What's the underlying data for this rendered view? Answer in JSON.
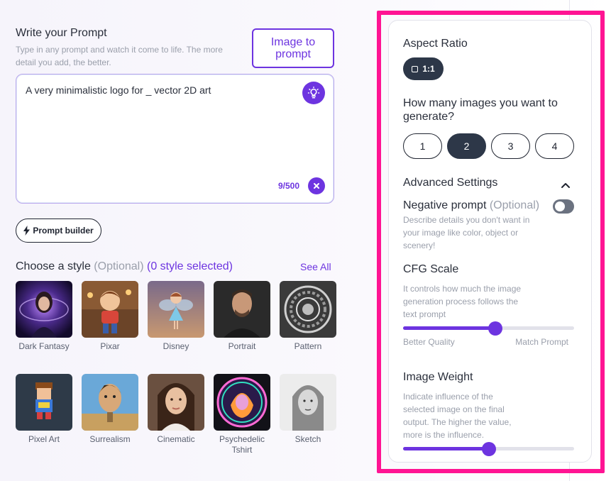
{
  "prompt": {
    "title": "Write your Prompt",
    "description": "Type in any prompt and watch it come to life. The more detail you add, the better.",
    "image_to_prompt_label": "Image to prompt",
    "value": "A very minimalistic logo for _ vector 2D art",
    "counter": "9/500",
    "builder_label": "Prompt builder"
  },
  "style": {
    "title": "Choose a style",
    "optional": "(Optional)",
    "selected": "(0 style selected)",
    "see_all": "See All",
    "tiles": [
      {
        "label": "Dark Fantasy"
      },
      {
        "label": "Pixar"
      },
      {
        "label": "Disney"
      },
      {
        "label": "Portrait"
      },
      {
        "label": "Pattern"
      },
      {
        "label": "Pixel Art"
      },
      {
        "label": "Surrealism"
      },
      {
        "label": "Cinematic"
      },
      {
        "label": "Psychedelic Tshirt"
      },
      {
        "label": "Sketch"
      }
    ]
  },
  "settings": {
    "aspect_ratio_title": "Aspect Ratio",
    "aspect_ratio_value": "1:1",
    "count_title": "How many images you want to generate?",
    "count_options": [
      "1",
      "2",
      "3",
      "4"
    ],
    "count_selected": "2",
    "advanced_title": "Advanced Settings",
    "negative_title": "Negative prompt",
    "negative_optional": "(Optional)",
    "negative_enabled": false,
    "negative_desc": "Describe details you don't want in your image like color, object or scenery!",
    "cfg_title": "CFG Scale",
    "cfg_desc": "It controls how much the image generation process follows the text prompt",
    "cfg_value_fraction": 0.54,
    "cfg_left_label": "Better Quality",
    "cfg_right_label": "Match Prompt",
    "weight_title": "Image Weight",
    "weight_desc": "Indicate influence of the selected image on the final output. The higher the value, more is the influence.",
    "weight_value_fraction": 0.5
  },
  "colors": {
    "accent": "#6d34e0",
    "dark_chip": "#2d3748",
    "highlight": "#ff1493"
  }
}
